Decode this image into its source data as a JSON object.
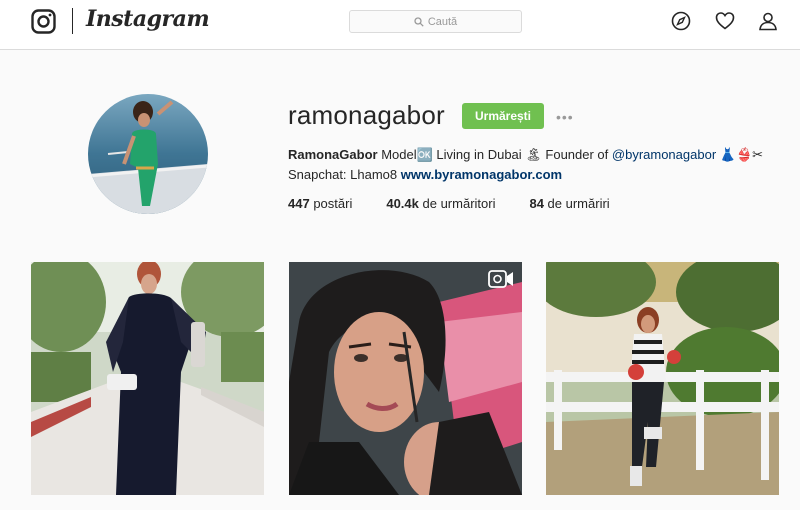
{
  "header": {
    "brand": "Instagram",
    "search_placeholder": "Caută",
    "icons": [
      "instagram-logo-icon",
      "search-icon",
      "compass-icon",
      "heart-icon",
      "user-icon"
    ]
  },
  "profile": {
    "username": "ramonagabor",
    "follow_label": "Urmărești",
    "more_label": "•••",
    "full_name": "RamonaGabor",
    "bio_line1_text": " Model🆗 Living in Dubai 🏝 Founder of ",
    "mention": "@byramonagabor",
    "bio_line1_emoji": " 👗👙✂",
    "bio_line2_text": "Snapchat: Lhamo8 ",
    "website": "www.byramonagabor.com",
    "stats": {
      "posts_count": "447",
      "posts_label": " postări",
      "followers_count": "40.4k",
      "followers_label": " de urmăritori",
      "following_count": "84",
      "following_label": " de urmăriri"
    }
  },
  "posts": [
    {
      "type": "photo",
      "description_icon": "image"
    },
    {
      "type": "video",
      "description_icon": "video-camera-icon"
    },
    {
      "type": "photo",
      "description_icon": "image"
    }
  ],
  "colors": {
    "follow_button": "#70c050",
    "link": "#003569",
    "border": "#dbdbdb"
  }
}
